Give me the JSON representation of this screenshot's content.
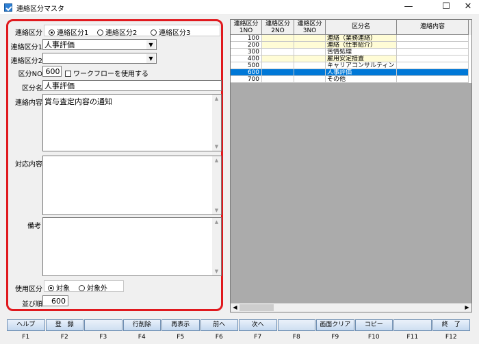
{
  "window": {
    "title": "連絡区分マスタ",
    "minimize": "—",
    "maximize": "☐",
    "close": "✕"
  },
  "form": {
    "type_label": "連絡区分",
    "type_options": [
      "連絡区分1",
      "連絡区分2",
      "連絡区分3"
    ],
    "type_selected": 0,
    "kubun1_label": "連絡区分1",
    "kubun1_value": "人事評価",
    "kubun2_label": "連絡区分2",
    "kubun2_value": "",
    "kubun_no_label": "区分NO",
    "kubun_no_value": "600",
    "workflow_label": "ワークフローを使用する",
    "workflow_checked": false,
    "kubun_name_label": "区分名",
    "kubun_name_value": "人事評価",
    "content_label": "連絡内容",
    "content_value": "賞与査定内容の通知",
    "response_label": "対応内容",
    "response_value": "",
    "remarks_label": "備考",
    "remarks_value": "",
    "usage_label": "使用区分",
    "usage_options": [
      "対象",
      "対象外"
    ],
    "usage_selected": 0,
    "order_label": "並び順",
    "order_value": "600"
  },
  "grid": {
    "headers": [
      {
        "line1": "連絡区分",
        "line2": "1NO"
      },
      {
        "line1": "連絡区分",
        "line2": "2NO"
      },
      {
        "line1": "連絡区分",
        "line2": "3NO"
      },
      {
        "line1": "区分名",
        "line2": ""
      },
      {
        "line1": "連絡内容",
        "line2": ""
      }
    ],
    "rows": [
      {
        "no1": "100",
        "no2": "",
        "no3": "",
        "name": "連絡（業務連絡）",
        "content": "",
        "highlight": "#fffcd6",
        "selected": false
      },
      {
        "no1": "200",
        "no2": "",
        "no3": "",
        "name": "連絡（仕事紹介）",
        "content": "",
        "highlight": "#fffcd6",
        "selected": false
      },
      {
        "no1": "300",
        "no2": "",
        "no3": "",
        "name": "苦情処理",
        "content": "",
        "highlight": "",
        "selected": false
      },
      {
        "no1": "400",
        "no2": "",
        "no3": "",
        "name": "雇用安定措置",
        "content": "",
        "highlight": "#fffcd6",
        "selected": false
      },
      {
        "no1": "500",
        "no2": "",
        "no3": "",
        "name": "キャリアコンサルティン",
        "content": "",
        "highlight": "",
        "selected": false
      },
      {
        "no1": "600",
        "no2": "",
        "no3": "",
        "name": "人事評価",
        "content": "",
        "highlight": "",
        "selected": true
      },
      {
        "no1": "700",
        "no2": "",
        "no3": "",
        "name": "その他",
        "content": "",
        "highlight": "",
        "selected": false
      }
    ]
  },
  "fkeys": [
    {
      "label": "ヘルプ",
      "key": "F1"
    },
    {
      "label": "登　録",
      "key": "F2"
    },
    {
      "label": "",
      "key": "F3"
    },
    {
      "label": "行削除",
      "key": "F4"
    },
    {
      "label": "再表示",
      "key": "F5"
    },
    {
      "label": "前へ",
      "key": "F6"
    },
    {
      "label": "次へ",
      "key": "F7"
    },
    {
      "label": "",
      "key": "F8"
    },
    {
      "label": "画面クリア",
      "key": "F9"
    },
    {
      "label": "コピー",
      "key": "F10"
    },
    {
      "label": "",
      "key": "F11"
    },
    {
      "label": "終　了",
      "key": "F12"
    }
  ],
  "colors": {
    "accent_border": "#e0191e",
    "selection": "#0078d7",
    "highlight_row": "#fffcd6"
  }
}
